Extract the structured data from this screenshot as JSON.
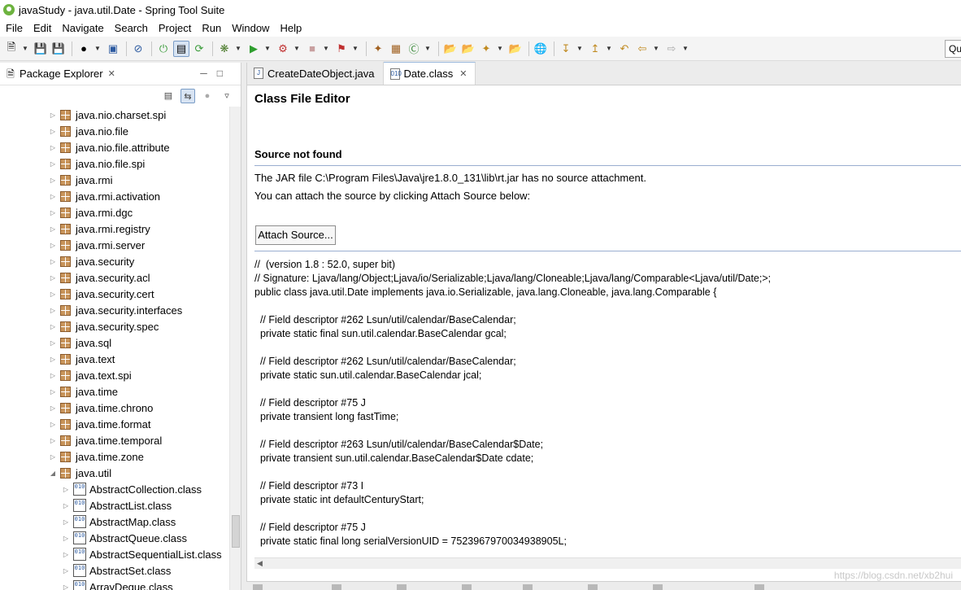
{
  "window": {
    "title": "javaStudy - java.util.Date - Spring Tool Suite"
  },
  "menu": [
    "File",
    "Edit",
    "Navigate",
    "Search",
    "Project",
    "Run",
    "Window",
    "Help"
  ],
  "quick_access": "Qu",
  "package_explorer": {
    "title": "Package Explorer",
    "items": [
      {
        "label": "java.nio.charset.spi",
        "kind": "package"
      },
      {
        "label": "java.nio.file",
        "kind": "package"
      },
      {
        "label": "java.nio.file.attribute",
        "kind": "package"
      },
      {
        "label": "java.nio.file.spi",
        "kind": "package"
      },
      {
        "label": "java.rmi",
        "kind": "package"
      },
      {
        "label": "java.rmi.activation",
        "kind": "package"
      },
      {
        "label": "java.rmi.dgc",
        "kind": "package"
      },
      {
        "label": "java.rmi.registry",
        "kind": "package"
      },
      {
        "label": "java.rmi.server",
        "kind": "package"
      },
      {
        "label": "java.security",
        "kind": "package"
      },
      {
        "label": "java.security.acl",
        "kind": "package"
      },
      {
        "label": "java.security.cert",
        "kind": "package"
      },
      {
        "label": "java.security.interfaces",
        "kind": "package"
      },
      {
        "label": "java.security.spec",
        "kind": "package"
      },
      {
        "label": "java.sql",
        "kind": "package"
      },
      {
        "label": "java.text",
        "kind": "package"
      },
      {
        "label": "java.text.spi",
        "kind": "package"
      },
      {
        "label": "java.time",
        "kind": "package"
      },
      {
        "label": "java.time.chrono",
        "kind": "package"
      },
      {
        "label": "java.time.format",
        "kind": "package"
      },
      {
        "label": "java.time.temporal",
        "kind": "package"
      },
      {
        "label": "java.time.zone",
        "kind": "package"
      },
      {
        "label": "java.util",
        "kind": "package",
        "expanded": true
      },
      {
        "label": "AbstractCollection.class",
        "kind": "class"
      },
      {
        "label": "AbstractList.class",
        "kind": "class"
      },
      {
        "label": "AbstractMap.class",
        "kind": "class"
      },
      {
        "label": "AbstractQueue.class",
        "kind": "class"
      },
      {
        "label": "AbstractSequentialList.class",
        "kind": "class"
      },
      {
        "label": "AbstractSet.class",
        "kind": "class"
      },
      {
        "label": "ArrayDeque.class",
        "kind": "class"
      }
    ]
  },
  "editor": {
    "tabs": [
      {
        "label": "CreateDateObject.java",
        "active": false
      },
      {
        "label": "Date.class",
        "active": true
      }
    ],
    "heading": "Class File Editor",
    "source_heading": "Source not found",
    "jar_message": "The JAR file C:\\Program Files\\Java\\jre1.8.0_131\\lib\\rt.jar has no source attachment.",
    "attach_message": "You can attach the source by clicking Attach Source below:",
    "attach_button": "Attach Source...",
    "code_lines": [
      "//  (version 1.8 : 52.0, super bit)",
      "// Signature: Ljava/lang/Object;Ljava/io/Serializable;Ljava/lang/Cloneable;Ljava/lang/Comparable<Ljava/util/Date;>;",
      "public class java.util.Date implements java.io.Serializable, java.lang.Cloneable, java.lang.Comparable {",
      "",
      "  // Field descriptor #262 Lsun/util/calendar/BaseCalendar;",
      "  private static final sun.util.calendar.BaseCalendar gcal;",
      "",
      "  // Field descriptor #262 Lsun/util/calendar/BaseCalendar;",
      "  private static sun.util.calendar.BaseCalendar jcal;",
      "",
      "  // Field descriptor #75 J",
      "  private transient long fastTime;",
      "",
      "  // Field descriptor #263 Lsun/util/calendar/BaseCalendar$Date;",
      "  private transient sun.util.calendar.BaseCalendar$Date cdate;",
      "",
      "  // Field descriptor #73 I",
      "  private static int defaultCenturyStart;",
      "",
      "  // Field descriptor #75 J",
      "  private static final long serialVersionUID = 7523967970034938905L;"
    ]
  },
  "watermark": "https://blog.csdn.net/xb2hui"
}
